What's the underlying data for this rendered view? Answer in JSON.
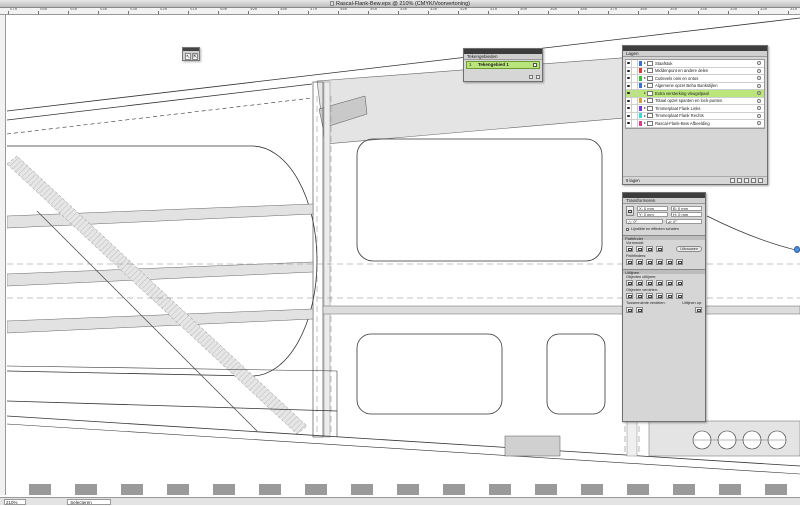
{
  "window": {
    "title": "Rascal-Flank-Bew.eps @ 210% (CMYK/Voorvertoning)"
  },
  "ruler": {
    "labels": [
      "570",
      "560",
      "550",
      "540",
      "530",
      "520",
      "510",
      "500",
      "490",
      "480",
      "470",
      "460",
      "450",
      "440",
      "430",
      "420",
      "410",
      "400",
      "390",
      "380",
      "370",
      "360",
      "350",
      "340",
      "330",
      "320",
      "310",
      "300"
    ]
  },
  "artboards_panel": {
    "tab": "Tekengebieden",
    "rows": [
      {
        "index": "1",
        "name": "Tekengebied 1"
      }
    ]
  },
  "layers_panel": {
    "tab": "Lagen",
    "layers": [
      {
        "name": "Staafstuk",
        "color": "#3b6fd8",
        "selected": false
      },
      {
        "name": "Middenpunt en andere delen",
        "color": "#d83b3b",
        "selected": false
      },
      {
        "name": "Cutlevels onis en ontos",
        "color": "#3bbf3b",
        "selected": false
      },
      {
        "name": "Algemene opzet Beha Bankstijlen",
        "color": "#3b6fd8",
        "selected": false
      },
      {
        "name": "Extra versterking vleugelpaal",
        "color": "#b9e57a",
        "selected": true
      },
      {
        "name": "Totaal opzet spanten en lock-punten",
        "color": "#d8a03b",
        "selected": false
      },
      {
        "name": "Timmerplaat Flank Links",
        "color": "#7a3bd8",
        "selected": false
      },
      {
        "name": "Timmerplaat Flank Rechts",
        "color": "#3bd8d8",
        "selected": false
      },
      {
        "name": "Rascal-Flank-Bew Afbeelding",
        "color": "#d83b8a",
        "selected": false
      }
    ],
    "footer": "9 lagen"
  },
  "transform_panel": {
    "tab": "Transformeren",
    "x_label": "X:",
    "x_value": "0 mm",
    "y_label": "Y:",
    "y_value": "0 mm",
    "w_label": "B:",
    "w_value": "0 mm",
    "h_label": "H:",
    "h_value": "0 mm",
    "angle_label": "△:",
    "angle_value": "0°",
    "shear_label": "⊿:",
    "shear_value": "0°",
    "scale_checkbox": "Lijndikte en effecten schalen"
  },
  "pathfinder_panel": {
    "tab": "Pathfinder",
    "shape_modes": "Vormmodi:",
    "expand": "Uitvouwen",
    "pathfinders": "Pathfinders:"
  },
  "align_panel": {
    "tab": "Uitlijnen",
    "align_objects": "Objecten uitlijnen:",
    "distribute_objects": "Objecten verdelen:",
    "distribute_spacing": "Tussenruimte verdelen:",
    "align_to": "Uitlijnen op:"
  },
  "statusbar": {
    "zoom": "210%",
    "tool": "Selecteren"
  }
}
